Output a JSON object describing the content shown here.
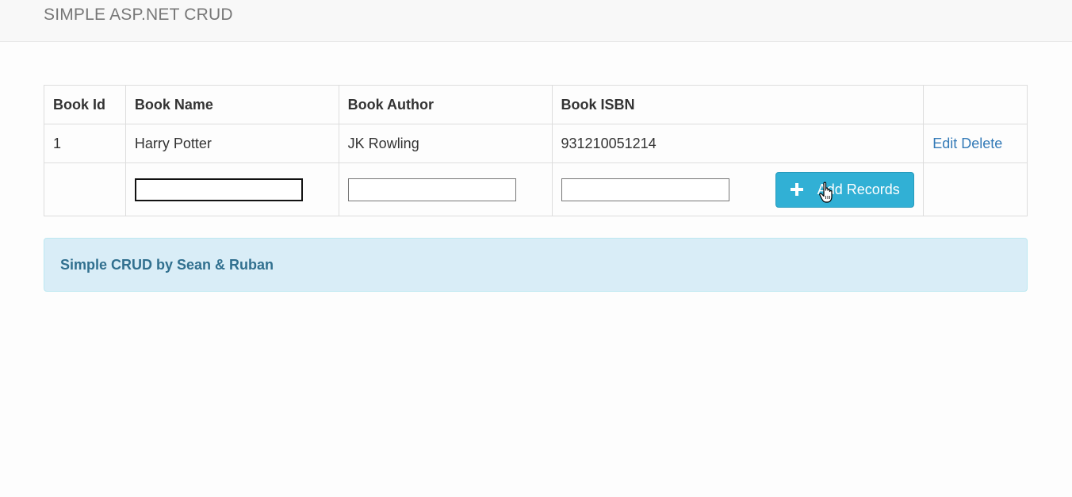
{
  "navbar": {
    "brand": "SIMPLE ASP.NET CRUD"
  },
  "table": {
    "headers": [
      "Book Id",
      "Book Name",
      "Book Author",
      "Book ISBN",
      ""
    ],
    "rows": [
      {
        "id": "1",
        "name": "Harry Potter",
        "author": "JK Rowling",
        "isbn": "931210051214",
        "edit": "Edit",
        "delete": "Delete"
      }
    ],
    "insert": {
      "name_value": "",
      "author_value": "",
      "isbn_value": "",
      "add_button": "Add Records",
      "add_icon": "plus-icon"
    }
  },
  "alert": {
    "text": "Simple CRUD by Sean & Ruban"
  },
  "colors": {
    "navbar_bg": "#f8f8f8",
    "link": "#337ab7",
    "button_bg": "#31b0d5",
    "alert_bg": "#d9edf7",
    "alert_text": "#31708f"
  }
}
